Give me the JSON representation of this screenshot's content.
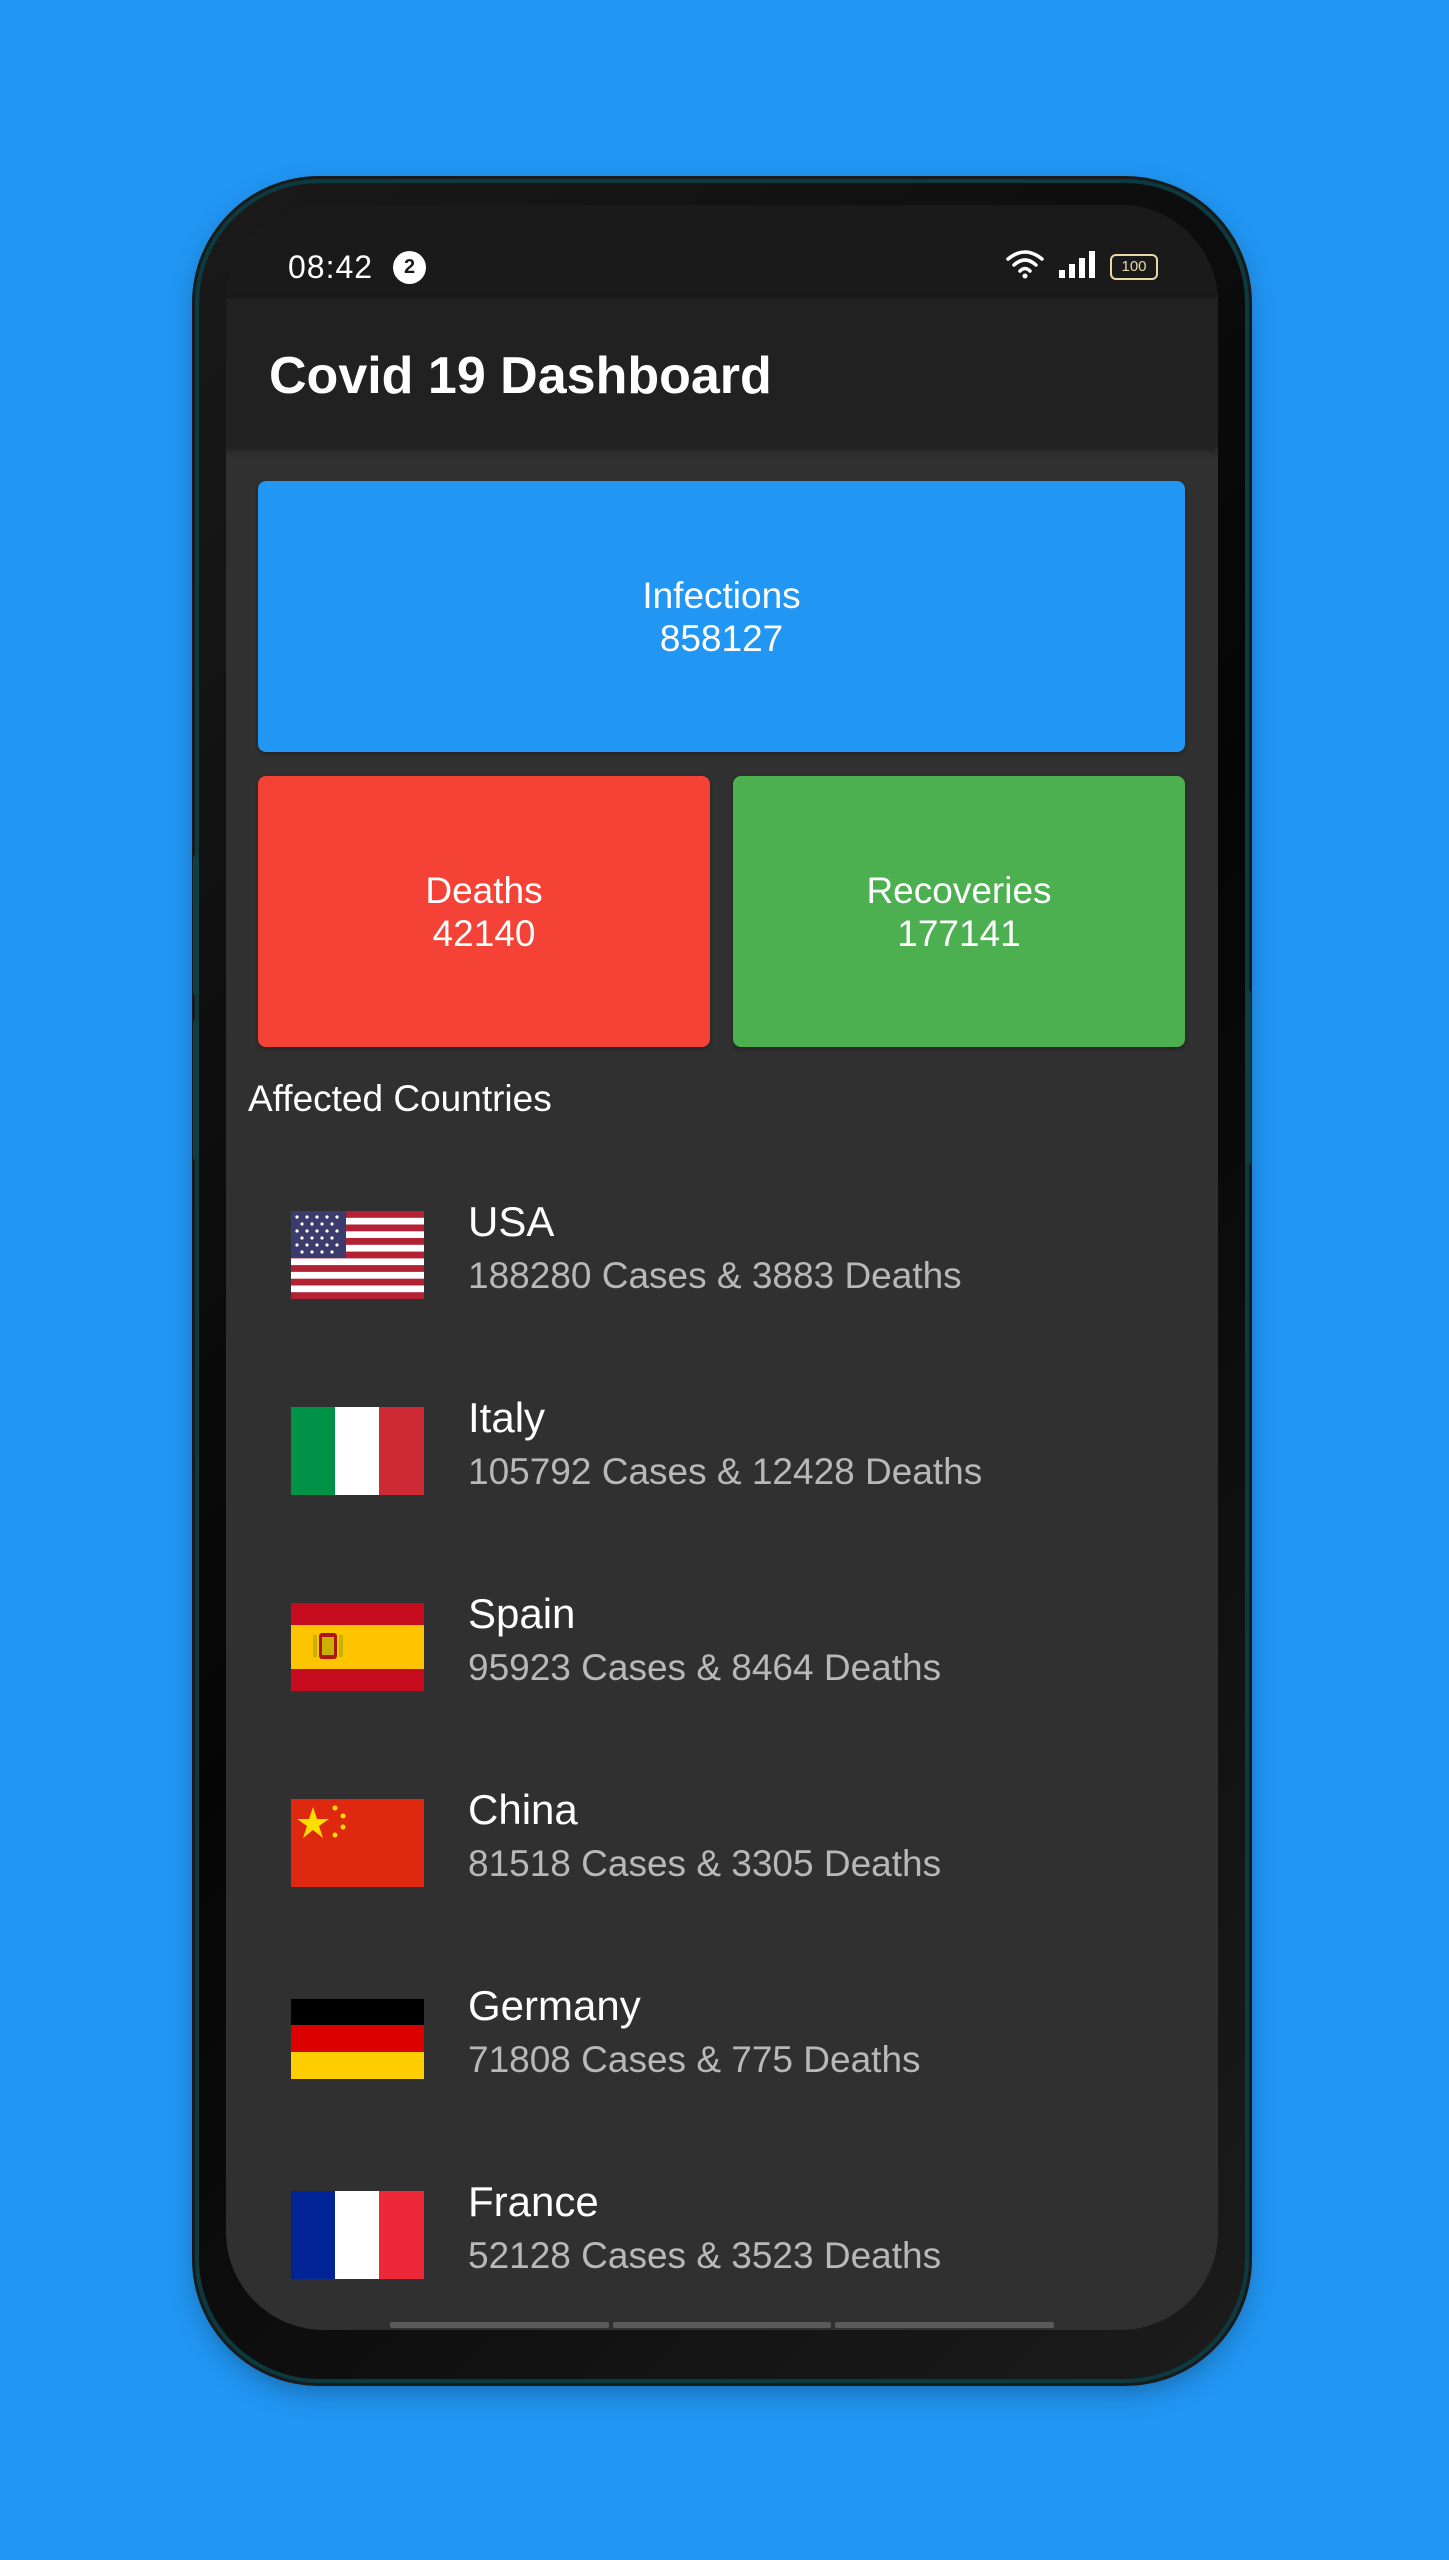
{
  "status_bar": {
    "time": "08:42",
    "notification_count": "2",
    "battery_level": "100",
    "icons": [
      "wifi-icon",
      "signal-icon",
      "battery-icon"
    ]
  },
  "app_bar": {
    "title": "Covid 19 Dashboard"
  },
  "summary": {
    "infections": {
      "label": "Infections",
      "value": "858127",
      "color": "#2196F3"
    },
    "deaths": {
      "label": "Deaths",
      "value": "42140",
      "color": "#F44336"
    },
    "recoveries": {
      "label": "Recoveries",
      "value": "177141",
      "color": "#4CAF50"
    }
  },
  "countries_section": {
    "title": "Affected Countries",
    "items": [
      {
        "name": "USA",
        "stats": "188280 Cases & 3883 Deaths",
        "flag": "usa-flag"
      },
      {
        "name": "Italy",
        "stats": "105792 Cases & 12428 Deaths",
        "flag": "italy-flag"
      },
      {
        "name": "Spain",
        "stats": "95923 Cases & 8464 Deaths",
        "flag": "spain-flag"
      },
      {
        "name": "China",
        "stats": "81518 Cases & 3305 Deaths",
        "flag": "china-flag"
      },
      {
        "name": "Germany",
        "stats": "71808 Cases & 775 Deaths",
        "flag": "germany-flag"
      },
      {
        "name": "France",
        "stats": "52128 Cases & 3523 Deaths",
        "flag": "france-flag"
      }
    ]
  },
  "colors": {
    "background": "#2196F3",
    "screen_background": "#303030",
    "app_bar": "#212121",
    "status_bar": "#1a1a1a"
  }
}
